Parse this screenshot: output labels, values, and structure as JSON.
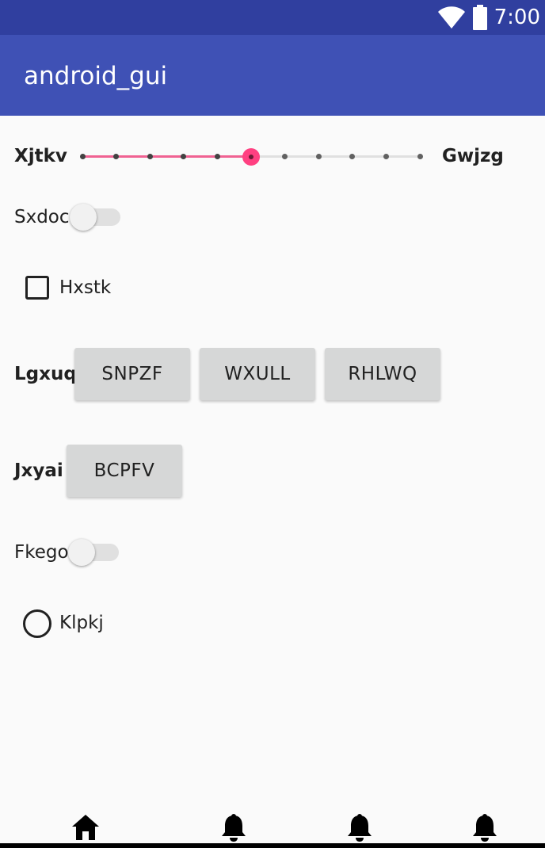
{
  "status_bar": {
    "time": "7:00"
  },
  "app_bar": {
    "title": "android_gui"
  },
  "seekbar": {
    "start_label": "Xjtkv",
    "end_label": "Gwjzg",
    "value": 5,
    "max": 10
  },
  "switch_1": {
    "label": "Sxdoc",
    "checked": false
  },
  "checkbox_1": {
    "label": "Hxstk",
    "checked": false
  },
  "button_group_1": {
    "label": "Lgxuq",
    "buttons": [
      "SNPZF",
      "WXULL",
      "RHLWQ"
    ]
  },
  "button_group_2": {
    "label": "Jxyai",
    "buttons": [
      "BCPFV"
    ]
  },
  "switch_2": {
    "label": "Fkego",
    "checked": false
  },
  "radio_1": {
    "label": "Klpkj",
    "checked": false
  },
  "bottom_nav": {
    "items": [
      {
        "icon": "home-icon"
      },
      {
        "icon": "bell-icon"
      },
      {
        "icon": "bell-icon"
      },
      {
        "icon": "bell-icon"
      }
    ]
  },
  "colors": {
    "primary": "#3f51b5",
    "primary_dark": "#303f9f",
    "accent": "#ff4081"
  }
}
